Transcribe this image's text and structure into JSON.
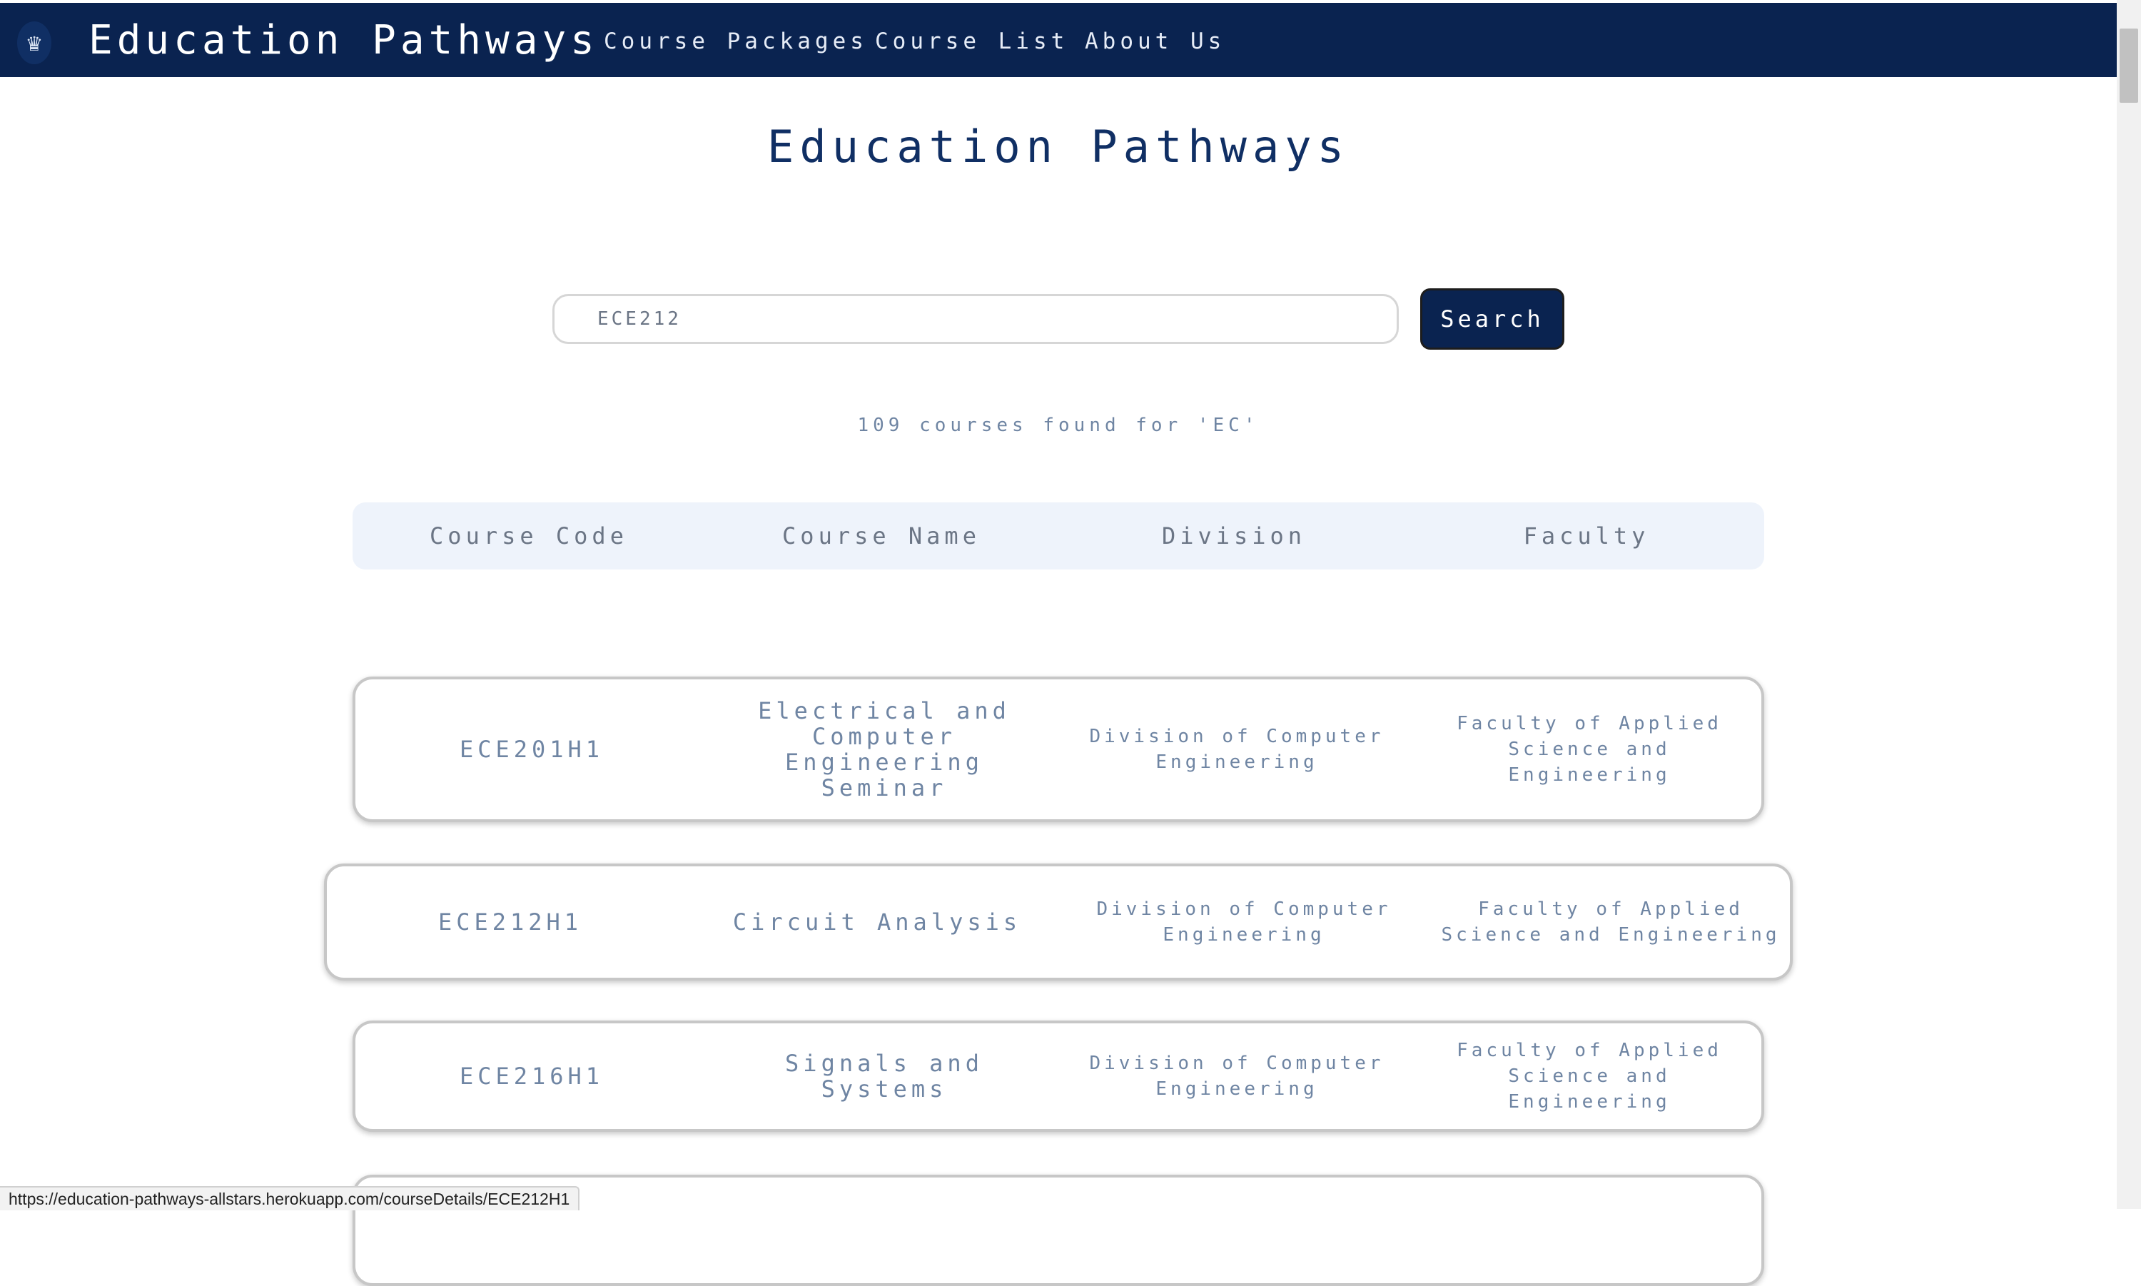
{
  "navbar": {
    "logo_icon": "crest-icon",
    "brand": "Education Pathways",
    "links": [
      "Course Packages",
      "Course List",
      "About Us"
    ]
  },
  "page_title": "Education Pathways",
  "search": {
    "value": "ECE212",
    "button_label": "Search"
  },
  "result_count": "109 courses found for 'EC'",
  "table": {
    "headers": [
      "Course Code",
      "Course Name",
      "Division",
      "Faculty"
    ],
    "rows": [
      {
        "code": "ECE201H1",
        "name": "Electrical and Computer Engineering Seminar",
        "division": "Division of Computer Engineering",
        "faculty": "Faculty of Applied Science and Engineering"
      },
      {
        "code": "ECE212H1",
        "name": "Circuit Analysis",
        "division": "Division of Computer Engineering",
        "faculty": "Faculty of Applied Science and Engineering"
      },
      {
        "code": "ECE216H1",
        "name": "Signals and Systems",
        "division": "Division of Computer Engineering",
        "faculty": "Faculty of Applied Science and Engineering"
      }
    ]
  },
  "status_bar": {
    "url": "https://education-pathways-allstars.herokuapp.com/courseDetails/ECE212H1"
  },
  "colors": {
    "navbar": "#0a2350",
    "accent_text": "#6f85a3",
    "header_bg": "#eef3fb"
  }
}
